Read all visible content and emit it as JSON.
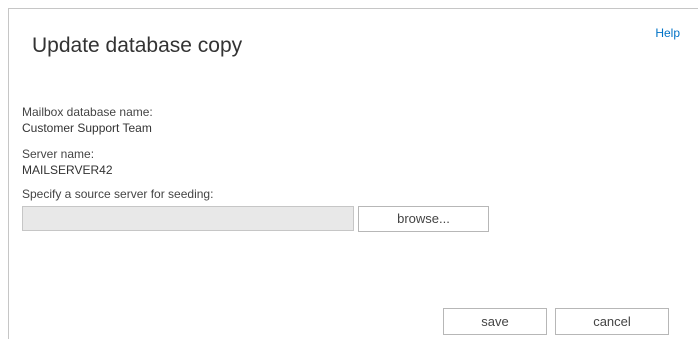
{
  "dialog": {
    "help_label": "Help",
    "title": "Update database copy"
  },
  "fields": {
    "mailbox_database": {
      "label": "Mailbox database name:",
      "value": "Customer Support Team"
    },
    "server": {
      "label": "Server name:",
      "value": "MAILSERVER42"
    },
    "source_server": {
      "label": "Specify a source server for seeding:",
      "value": ""
    }
  },
  "buttons": {
    "browse_label": "browse...",
    "save_label": "save",
    "cancel_label": "cancel"
  },
  "colors": {
    "link": "#0072c6",
    "input_background": "#e8e8e8",
    "border": "#c6c6c6"
  }
}
